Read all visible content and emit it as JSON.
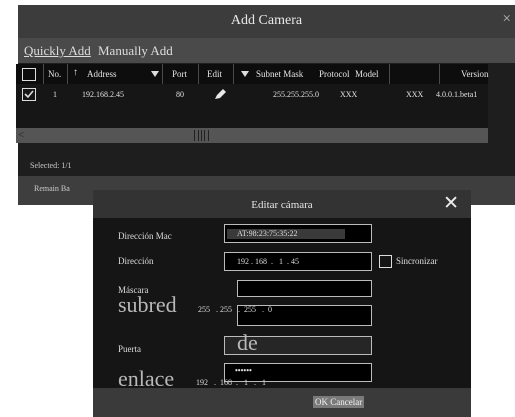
{
  "add_camera": {
    "title": "Add Camera",
    "close": "×",
    "tabs": {
      "quickly": "Quickly Add",
      "manually": "Manually Add"
    },
    "columns": {
      "no": "No.",
      "sort_arrow": "↑",
      "address": "Address",
      "port": "Port",
      "edit": "Edit",
      "subnet": "Subnet Mask",
      "protocol": "Protocol",
      "model": "Model",
      "version": "Version"
    },
    "row": {
      "no": "1",
      "address": "192.168.2.45",
      "port": "80",
      "subnet": "255.255.255.0",
      "protocol": "XXX",
      "model": "XXX",
      "version": "4.0.0.1.beta1"
    },
    "scroll_left": "<",
    "selected": "Selected: 1/1",
    "remain": "Remain Ba"
  },
  "edit_camera": {
    "title": "Editar cámara",
    "close": "✕",
    "mac_label": "Dirección Mac",
    "mac_value": "AT:98:23:75:35:22",
    "address_label": "Dirección",
    "address_value": "192 . 168  .   1  . 45",
    "sync_label": "Sincronizar",
    "mask_label": "Máscara",
    "mask_big": "subred",
    "mask_value": "255   . 255   .  255   .  0",
    "gateway_label": "Puerta",
    "gateway_big": "de",
    "gateway_big2": "enlace",
    "gateway_value": "192   .  168  .   1   .   1",
    "password_value": "••••••",
    "ok_cancel": "OK Cancelar"
  },
  "colors": {
    "dark_bg": "#1e1e1e",
    "titlebar": "#3c3c3c",
    "field_border": "#bbbbbb"
  }
}
